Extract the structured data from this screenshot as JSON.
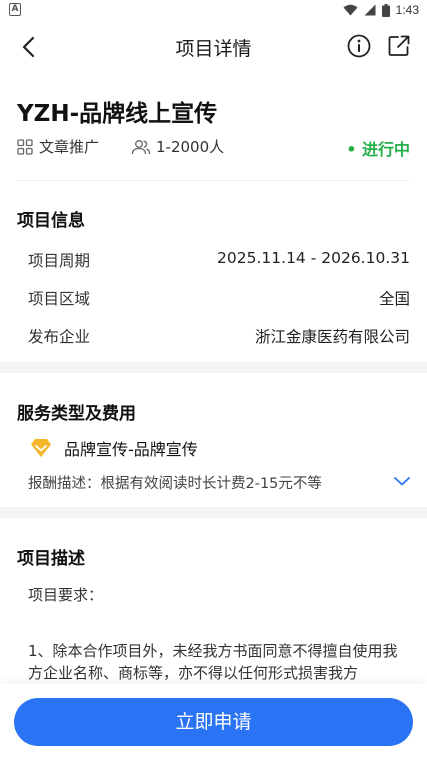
{
  "status_bar": {
    "time": "1:43",
    "notification_glyph": "A"
  },
  "nav": {
    "title": "项目详情"
  },
  "project": {
    "title": "YZH-品牌线上宣传",
    "category": "文章推广",
    "people": "1-2000人",
    "status": "• 进行中"
  },
  "info": {
    "heading": "项目信息",
    "rows": [
      {
        "label": "项目周期",
        "value": "2025.11.14 - 2026.10.31"
      },
      {
        "label": "项目区域",
        "value": "全国"
      },
      {
        "label": "发布企业",
        "value": "浙江金康医药有限公司"
      }
    ]
  },
  "service": {
    "heading": "服务类型及费用",
    "name": "品牌宣传-品牌宣传",
    "reward": "报酬描述：根据有效阅读时长计费2-15元不等"
  },
  "description": {
    "heading": "项目描述",
    "requirement_label": "项目要求：",
    "text": "1、除本合作项目外，未经我方书面同意不得擅自使用我方企业名称、商标等，亦不得以任何形式损害我方"
  },
  "footer": {
    "apply_label": "立即申请"
  },
  "colors": {
    "accent": "#2b73f5",
    "status": "#23b04a",
    "service_icon": "#f6b62a"
  }
}
